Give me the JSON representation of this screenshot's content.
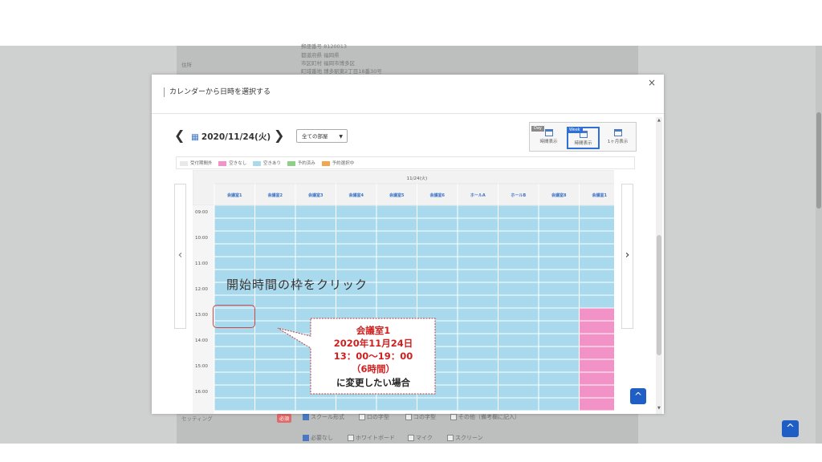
{
  "background": {
    "address_label": "住所",
    "address_lines": [
      "郵便番号 8120013",
      "都道府県 福岡県",
      "市区町村 福岡市博多区",
      "町域番地 博多駅東2丁目18番30号"
    ],
    "setting_label": "セッティング",
    "required_badge": "必須",
    "setting_options": [
      "スクール形式",
      "口の字型",
      "コの字型",
      "その他（備考欄に記入）"
    ],
    "equipment_options": [
      "必要なし",
      "ホワイトボード",
      "マイク",
      "スクリーン"
    ],
    "page_top_icon": "^"
  },
  "modal": {
    "title": "カレンダーから日時を選択する",
    "close_label": "×",
    "date_label": "2020/11/24(火)",
    "prev_label": "❮",
    "next_label": "❯",
    "room_select": "全ての部屋",
    "views": [
      {
        "tag": "Day",
        "label": "時間表示",
        "active": false
      },
      {
        "tag": "Week",
        "label": "時間表示",
        "active": true
      },
      {
        "tag": "",
        "label": "1ヶ月表示",
        "active": false
      }
    ],
    "legend": [
      {
        "label": "受付期間外",
        "color": "#e8e8e8"
      },
      {
        "label": "空きなし",
        "color": "#f392c6"
      },
      {
        "label": "空きあり",
        "color": "#a9d9ec"
      },
      {
        "label": "予約済み",
        "color": "#8fcf88"
      },
      {
        "label": "予約選択中",
        "color": "#f4a54f"
      }
    ],
    "grid_date": "11/24(火)",
    "rooms": [
      "会議室1",
      "会議室2",
      "会議室3",
      "会議室4",
      "会議室5",
      "会議室6",
      "ホールA",
      "ホールB",
      "会議室8",
      "会議室1"
    ],
    "times": [
      "09:00",
      "10:00",
      "11:00",
      "12:00",
      "13:00",
      "14:00",
      "15:00",
      "16:00"
    ],
    "unavailable_from": "13:00",
    "annotation": "開始時間の枠をクリック",
    "callout_lines": [
      "会議室1",
      "2020年11月24日",
      "13：00〜19：00",
      "（6時間）",
      "に変更したい場合"
    ],
    "scroll_top_icon": "^"
  },
  "colors": {
    "available": "#a9d9ec",
    "unavailable": "#f392c6",
    "accent": "#1f5fc5",
    "callout_red": "#d02020"
  }
}
